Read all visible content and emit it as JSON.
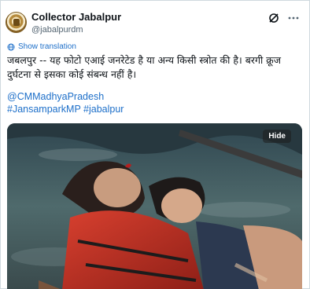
{
  "post": {
    "author_name": "Collector Jabalpur",
    "author_handle": "@jabalpurdm",
    "show_translation": "Show translation",
    "text": "जबलपुर -- यह फोटो एआई जनरेटेड है या अन्य किसी स्त्रोत की है। बरगी क्रूज दुर्घटना से इसका कोई संबन्ध नहीं है।",
    "mentions": [
      "@CMMadhyaPradesh",
      "#JansamparkMP #jabalpur"
    ],
    "media_hide_label": "Hide"
  },
  "icons": {
    "avatar": "district-seal-avatar",
    "grok": "grok-icon",
    "more": "more-options-icon",
    "translate": "globe-icon"
  },
  "colors": {
    "link": "#1d6fc9",
    "text": "#0f1419",
    "secondary": "#536471"
  }
}
